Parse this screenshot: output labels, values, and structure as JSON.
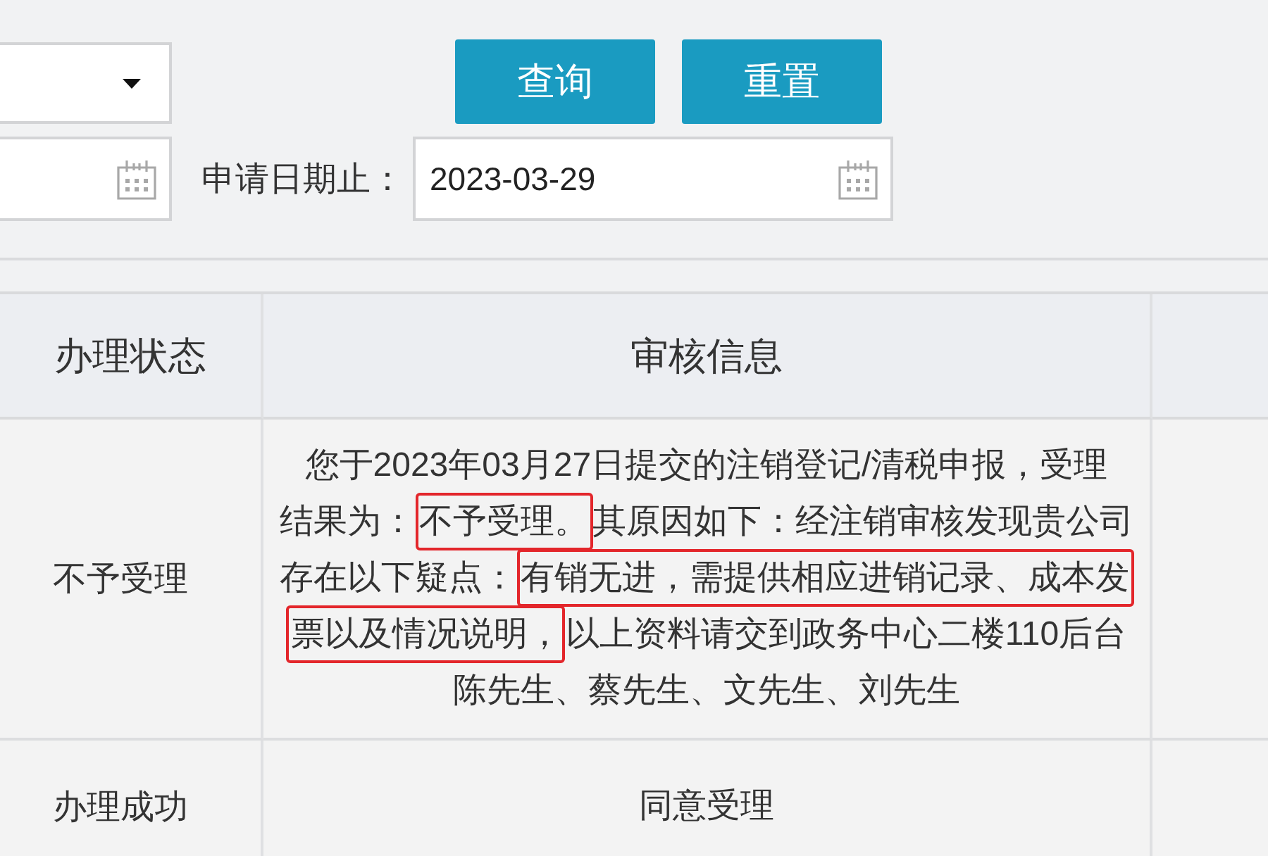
{
  "filters": {
    "rows": [
      {
        "fields": [
          {
            "kind": "select"
          }
        ],
        "buttons": [
          {
            "label": "查询"
          },
          {
            "label": "重置"
          }
        ]
      },
      {
        "fields": [
          {
            "kind": "date"
          },
          {
            "kind": "date",
            "label": "申请日期止：",
            "value": "2023-03-29"
          }
        ]
      }
    ]
  },
  "table": {
    "columns": [
      {
        "label": "办理状态"
      },
      {
        "label": "审核信息"
      }
    ],
    "rows": [
      {
        "status": "不予受理",
        "message": [
          [
            {
              "text": "您于2023年03月27日提交的注销登记/清税申报，受理",
              "highlighted": false
            }
          ],
          [
            {
              "text": "结果为：",
              "highlighted": false
            },
            {
              "text": "不予受理。",
              "highlighted": true
            },
            {
              "text": "其原因如下：经注销审核发现贵公司",
              "highlighted": false
            }
          ],
          [
            {
              "text": "存在以下疑点：",
              "highlighted": false
            },
            {
              "text": "有销无进，需提供相应进销记录、成本发",
              "highlighted": true
            }
          ],
          [
            {
              "text": "票以及情况说明，",
              "highlighted": true
            },
            {
              "text": "以上资料请交到政务中心二楼110后台",
              "highlighted": false
            }
          ],
          [
            {
              "text": "陈先生、蔡先生、文先生、刘先生",
              "highlighted": false
            }
          ]
        ]
      },
      {
        "status": "办理成功",
        "message": [
          [
            {
              "text": "同意受理",
              "highlighted": false
            }
          ]
        ]
      }
    ]
  }
}
